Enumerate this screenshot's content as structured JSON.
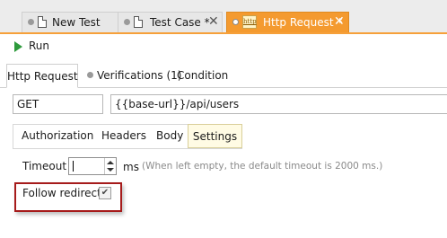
{
  "editor_tabs": [
    {
      "label": "New Test",
      "close": "✕",
      "icon": "document-icon"
    },
    {
      "label": "Test Case *",
      "close": "✕",
      "icon": "document-icon"
    },
    {
      "label": "Http Request *",
      "close": "✕",
      "icon": "http-icon",
      "icon_text": "http",
      "active": true
    }
  ],
  "toolbar": {
    "run_label": "Run"
  },
  "sub_tabs": [
    {
      "label": "Http Request",
      "active": true
    },
    {
      "label": "Verifications (1)"
    },
    {
      "label": "Condition"
    }
  ],
  "request": {
    "method": "GET",
    "url": "{{base-url}}/api/users"
  },
  "request_tabs": [
    {
      "label": "Authorization"
    },
    {
      "label": "Headers"
    },
    {
      "label": "Body"
    },
    {
      "label": "Settings",
      "selected": true
    }
  ],
  "settings": {
    "timeout_label": "Timeout",
    "timeout_value": "",
    "timeout_unit": "ms",
    "timeout_hint": "(When left empty, the default timeout is 2000 ms.)",
    "follow_redirects_label": "Follow redirects",
    "follow_redirects_checked": true,
    "check_mark": "✔"
  },
  "colors": {
    "active_tab": "#f49a2f",
    "run_icon": "#2e9a3c",
    "highlight_border": "#a61b1b",
    "selected_tab_bg": "#fffbe4"
  }
}
